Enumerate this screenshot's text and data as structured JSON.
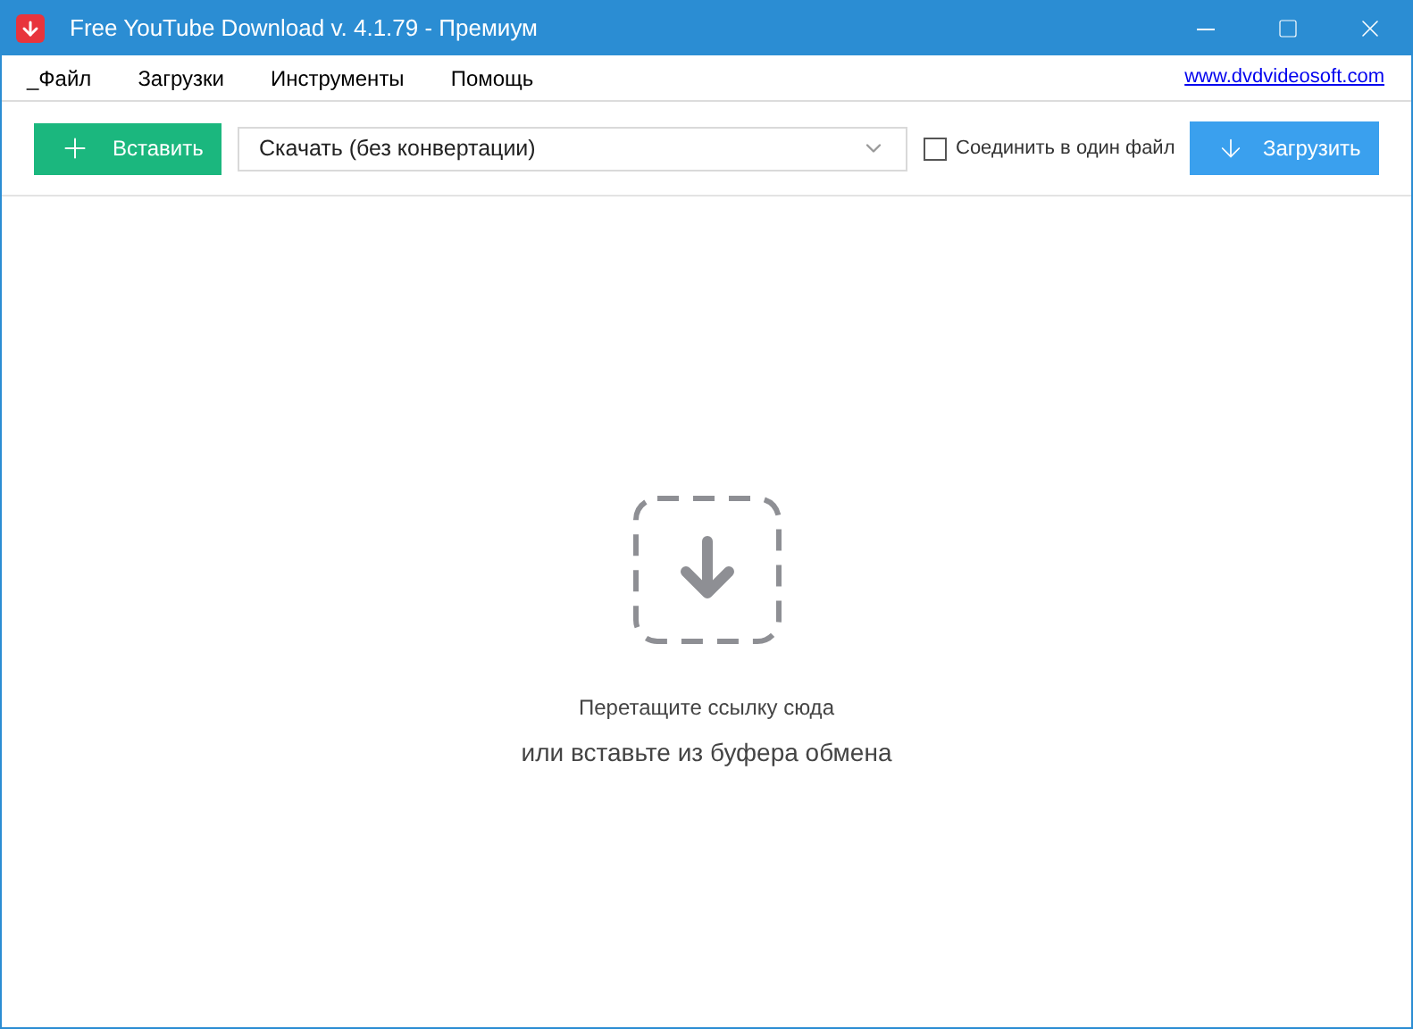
{
  "window": {
    "title": "Free YouTube Download v. 4.1.79 - Премиум"
  },
  "menu": {
    "items": [
      "_Файл",
      "Загрузки",
      "Инструменты",
      "Помощь"
    ],
    "link": "www.dvdvideosoft.com"
  },
  "toolbar": {
    "paste_button": "Вставить",
    "format_select": {
      "value": "Скачать (без конвертации)"
    },
    "join_checkbox": {
      "label": "Соединить в один файл",
      "checked": false
    },
    "download_button": "Загрузить"
  },
  "drop_zone": {
    "hint": "Перетащите ссылку сюда",
    "subhint": "или вставьте из буфера обмена"
  }
}
